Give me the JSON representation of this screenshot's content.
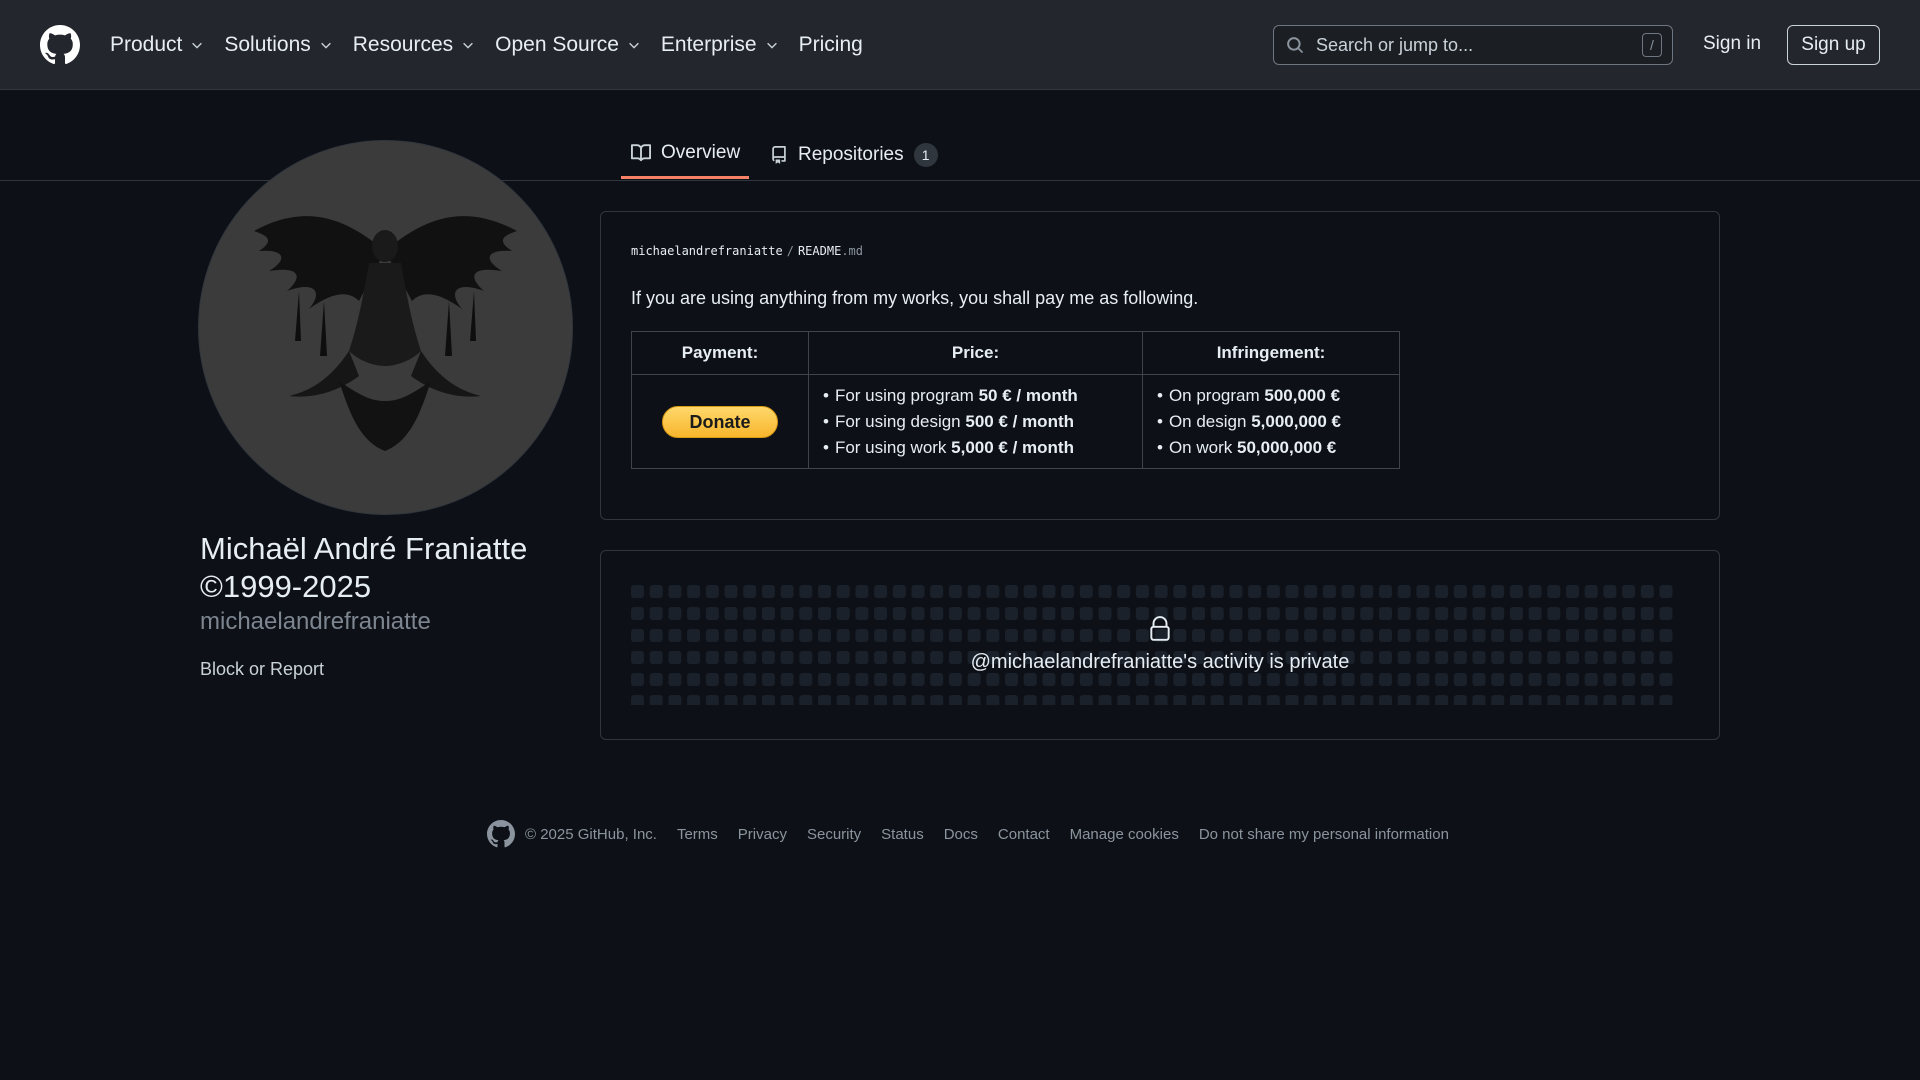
{
  "header": {
    "nav": [
      {
        "label": "Product",
        "has_dropdown": true
      },
      {
        "label": "Solutions",
        "has_dropdown": true
      },
      {
        "label": "Resources",
        "has_dropdown": true
      },
      {
        "label": "Open Source",
        "has_dropdown": true
      },
      {
        "label": "Enterprise",
        "has_dropdown": true
      },
      {
        "label": "Pricing",
        "has_dropdown": false
      }
    ],
    "search_placeholder": "Search or jump to...",
    "search_shortcut": "/",
    "sign_in": "Sign in",
    "sign_up": "Sign up",
    "icons": [
      "github-logo-icon",
      "search-icon",
      "chevron-down-icon"
    ]
  },
  "tabs": [
    {
      "label": "Overview",
      "icon": "book-icon",
      "selected": true
    },
    {
      "label": "Repositories",
      "icon": "repo-icon",
      "count": "1"
    }
  ],
  "profile": {
    "name_line1": "Michaël André Franiatte",
    "name_line2": "©1999-2025",
    "username": "michaelandrefraniatte",
    "block_report": "Block or Report"
  },
  "readme": {
    "owner": "michaelandrefraniatte",
    "separator": "/",
    "file": "README",
    "ext": ".md",
    "intro": "If you are using anything from my works, you shall pay me as following.",
    "table": {
      "headers": [
        "Payment:",
        "Price:",
        "Infringement:"
      ],
      "donate_label": "Donate",
      "price": [
        {
          "text": "For using program ",
          "bold": "50 € / month"
        },
        {
          "text": "For using design ",
          "bold": "500 € / month"
        },
        {
          "text": "For using work ",
          "bold": "5,000 € / month"
        }
      ],
      "infringement": [
        {
          "text": "On program ",
          "bold": "500,000 €"
        },
        {
          "text": "On design ",
          "bold": "5,000,000 €"
        },
        {
          "text": "On work ",
          "bold": "50,000,000 €"
        }
      ]
    }
  },
  "activity": {
    "private_text": "@michaelandrefraniatte's activity is private"
  },
  "footer": {
    "copyright": "© 2025 GitHub, Inc.",
    "links": [
      "Terms",
      "Privacy",
      "Security",
      "Status",
      "Docs",
      "Contact",
      "Manage cookies",
      "Do not share my personal information"
    ]
  },
  "colors": {
    "background": "#0d1117",
    "header": "#23262c",
    "tab_underline": "#f78166",
    "donate": "#f7b52c",
    "muted": "#7d8590"
  }
}
